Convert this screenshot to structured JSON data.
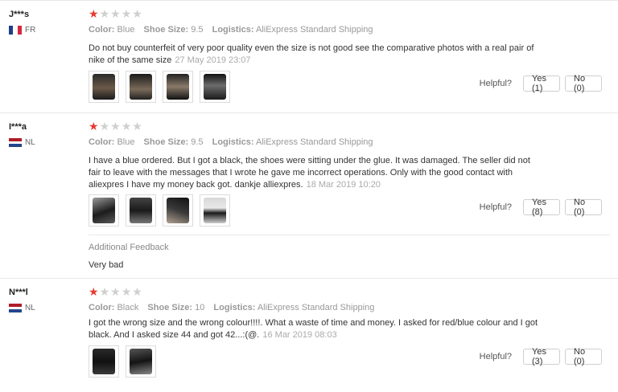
{
  "colors": {
    "star_on": "#e63b2e",
    "star_off": "#cfcfcf",
    "muted": "#999999",
    "fr": [
      "#1f3d8a",
      "#ffffff",
      "#d7263d"
    ],
    "nl": [
      "#ae1c28",
      "#ffffff",
      "#21468b"
    ]
  },
  "labels": {
    "color": "Color:",
    "shoe_size": "Shoe Size:",
    "logistics": "Logistics:",
    "helpful": "Helpful?"
  },
  "reviews": [
    {
      "user": "J***s",
      "country": "FR",
      "flag_icon": "france-flag-icon",
      "rating": 1,
      "color": "Blue",
      "shoe_size": "9.5",
      "logistics": "AliExpress Standard Shipping",
      "text": "Do not buy counterfeit of very poor quality even the size is not good see the comparative photos with a real pair of nike of the same size",
      "date": "27 May 2019 23:07",
      "photos": 4,
      "yes": "Yes (1)",
      "no": "No (0)"
    },
    {
      "user": "I***a",
      "country": "NL",
      "flag_icon": "netherlands-flag-icon",
      "rating": 1,
      "color": "Blue",
      "shoe_size": "9.5",
      "logistics": "AliExpress Standard Shipping",
      "text": "I have a blue ordered. But I got a black, the shoes were sitting under the glue. It was damaged. The seller did not fair to leave with the messages that I wrote he gave me incorrect operations. Only with the good contact with aliexpres I have my money back got. dankje alliexpres.",
      "date": "18 Mar 2019 10:20",
      "photos": 4,
      "yes": "Yes (8)",
      "no": "No (0)",
      "additional_feedback_title": "Additional Feedback",
      "additional_feedback": "Very bad"
    },
    {
      "user": "N***l",
      "country": "NL",
      "flag_icon": "netherlands-flag-icon",
      "rating": 1,
      "color": "Black",
      "shoe_size": "10",
      "logistics": "AliExpress Standard Shipping",
      "text": "I got the wrong size and the wrong colour!!!!. What a waste of time and money. I asked for red/blue colour and I got black. And I asked size 44 and got 42...:(@.",
      "date": "16 Mar 2019 08:03",
      "photos": 2,
      "yes": "Yes (3)",
      "no": "No (0)"
    }
  ]
}
